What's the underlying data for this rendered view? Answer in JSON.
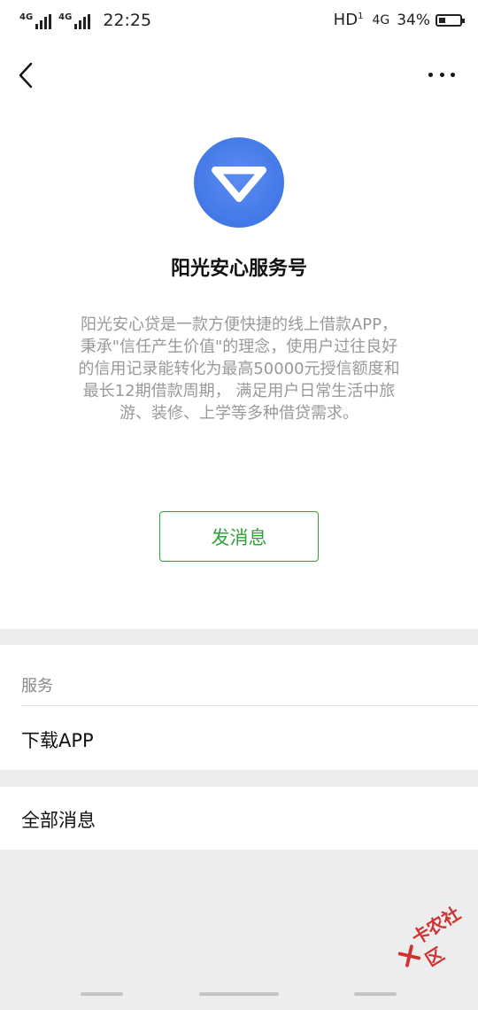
{
  "status_bar": {
    "signal_1": "4G",
    "signal_2": "4G",
    "time": "22:25",
    "hd": "HD",
    "hd_sup": "1",
    "network_right": "4G",
    "battery_pct": "34%",
    "battery_level": 0.34
  },
  "header": {
    "back_icon": "chevron-left-icon",
    "more_icon": "ellipsis-icon"
  },
  "profile": {
    "name": "阳光安心服务号",
    "description": "阳光安心贷是一款方便快捷的线上借款APP，秉承\"信任产生价值\"的理念，使用户过往良好的信用记录能转化为最高50000元授信额度和最长12期借款周期， 满足用户日常生活中旅游、装修、上学等多种借贷需求。",
    "logo_color": "#4a7eea",
    "send_button": "发消息",
    "accent": "#2fa33b"
  },
  "services": {
    "label": "服务",
    "items": [
      "下载APP"
    ]
  },
  "all_messages": "全部消息",
  "watermark": "卡农社区"
}
